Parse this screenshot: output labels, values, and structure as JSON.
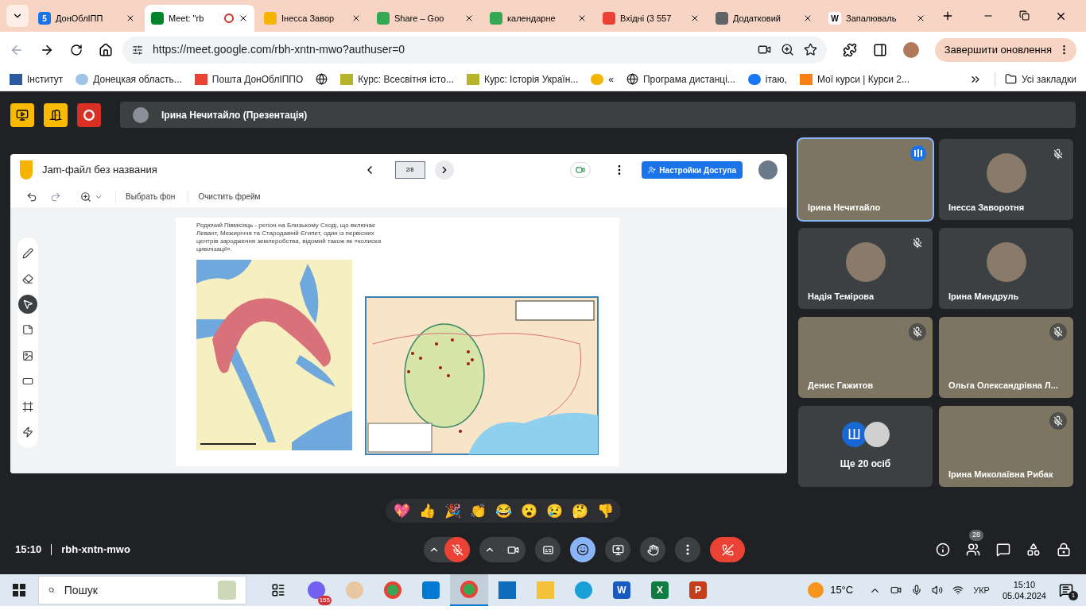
{
  "browser": {
    "tabs": [
      {
        "title": "ДонОблІПП",
        "kind": "calendar",
        "glyph": "5",
        "selected": false
      },
      {
        "title": "Meet: \"rb",
        "kind": "meet",
        "selected": true,
        "recording": true
      },
      {
        "title": "Інесса Завор",
        "kind": "jam",
        "selected": false
      },
      {
        "title": "Share – Goo",
        "kind": "drive",
        "selected": false
      },
      {
        "title": "календарне",
        "kind": "drive",
        "selected": false
      },
      {
        "title": "Вхідні (3 557",
        "kind": "gmail",
        "selected": false
      },
      {
        "title": "Додатковий",
        "kind": "bank",
        "selected": false
      },
      {
        "title": "Запалюваль",
        "kind": "wiki",
        "glyph": "W",
        "selected": false
      }
    ],
    "url": "https://meet.google.com/rbh-xntn-mwo?authuser=0",
    "update_button": "Завершити оновлення",
    "bookmarks": [
      {
        "label": "Інститут",
        "kind": "logo"
      },
      {
        "label": "Донецкая область...",
        "kind": "cloud"
      },
      {
        "label": "Пошта ДонОблІППО",
        "kind": "gmail"
      },
      {
        "kind": "globe"
      },
      {
        "label": "Курс: Всесвітня істо...",
        "kind": "course"
      },
      {
        "label": "Курс: Історія Україн...",
        "kind": "course"
      },
      {
        "label": "«",
        "kind": "sun"
      },
      {
        "label": "Програма дистанці...",
        "kind": "globe"
      },
      {
        "label": "ітаю,",
        "kind": "facebook"
      },
      {
        "label": "Мої курси | Курси 2...",
        "kind": "moodle"
      }
    ],
    "all_bookmarks": "Усі закладки"
  },
  "meet": {
    "presenter_banner": "Ірина Нечитайло (Презентація)",
    "jam": {
      "title": "Jam-файл без названия",
      "page_indicator": "2/8",
      "share_button": "Настройки Доступа",
      "toolbar": [
        "Выбрать фон",
        "Очистить фрейм"
      ],
      "tools": [
        {
          "kind": "pen",
          "selected": false
        },
        {
          "kind": "eraser",
          "selected": false
        },
        {
          "kind": "select",
          "selected": true
        },
        {
          "kind": "note",
          "selected": false
        },
        {
          "kind": "image",
          "selected": false
        },
        {
          "kind": "shape",
          "selected": false
        },
        {
          "kind": "textbox",
          "selected": false
        },
        {
          "kind": "laser",
          "selected": false
        }
      ],
      "slide_text": "Родючий Півмісяць - регіон на Близькому Сході, що включає Левант, Межиріччя та Стародавній Єгипет, один із первісних центрів зародження землеробства, відомий також як «колиска цивілізації»."
    },
    "participants": [
      {
        "name": "Ірина Нечитайло",
        "kind": "video",
        "muted": false,
        "speaking": true
      },
      {
        "name": "Інесса Заворотня",
        "kind": "avatar",
        "muted": true,
        "speaking": false
      },
      {
        "name": "Надія Темірова",
        "kind": "avatar",
        "muted": true,
        "speaking": false
      },
      {
        "name": "Ірина Миндруль",
        "kind": "avatar",
        "muted": false,
        "speaking": false
      },
      {
        "name": "Денис Гажитов",
        "kind": "video",
        "muted": true,
        "speaking": false
      },
      {
        "name": "Ольга Олександрівна Л...",
        "kind": "video",
        "muted": true,
        "speaking": false
      },
      {
        "name": "Ще 20 осіб",
        "kind": "more",
        "initial": "Ш"
      },
      {
        "name": "Ірина Миколаївна Рибак",
        "kind": "video",
        "muted": true,
        "speaking": false
      }
    ],
    "reactions": [
      "💖",
      "👍",
      "🎉",
      "👏",
      "😂",
      "😮",
      "😢",
      "🤔",
      "👎"
    ],
    "time": "15:10",
    "meeting_code": "rbh-xntn-mwo",
    "mic": {
      "muted": true
    },
    "camera": {
      "on": true
    },
    "reactions_button": {
      "on": true
    },
    "people_count": "28"
  },
  "taskbar": {
    "search_placeholder": "Пошук",
    "apps": [
      {
        "kind": "taskview"
      },
      {
        "kind": "viber",
        "badge": "155"
      },
      {
        "kind": "paint"
      },
      {
        "kind": "chrome",
        "selected": false
      },
      {
        "kind": "store"
      },
      {
        "kind": "chrome",
        "selected": true
      },
      {
        "kind": "mail"
      },
      {
        "kind": "explorer"
      },
      {
        "kind": "edge"
      },
      {
        "kind": "word",
        "glyph": "W"
      },
      {
        "kind": "excel",
        "glyph": "X"
      },
      {
        "kind": "powerpoint",
        "glyph": "P"
      }
    ],
    "weather": "15°C",
    "language": "УКР",
    "time": "15:10",
    "date": "05.04.2024",
    "notifications": "1"
  }
}
